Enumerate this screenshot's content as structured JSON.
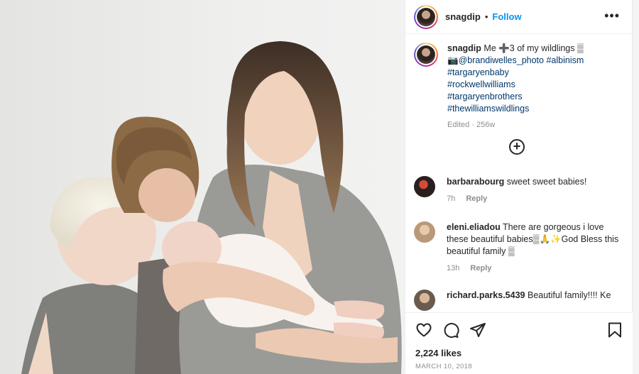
{
  "post": {
    "username": "snagdip",
    "follow_label": "Follow",
    "separator": "•",
    "more_label": "•••"
  },
  "caption": {
    "username": "snagdip",
    "text": "Me ➕3 of my wildlings ▒",
    "photo_credit": "📷@brandiwelles_photo",
    "hashtags": [
      "#albinism",
      "#targaryenbaby",
      "#rockwellwilliams",
      "#targaryenbrothers",
      "#thewilliamswildlings"
    ],
    "meta": "Edited · 256w"
  },
  "load_more_icon": "plus-circle-icon",
  "comments": [
    {
      "username": "barbarabourg",
      "text": "sweet sweet babies!",
      "time": "7h",
      "reply_label": "Reply",
      "avatar_color": "#3a2a2a"
    },
    {
      "username": "eleni.eliadou",
      "text": "There are gorgeous i love these beautiful babies▒🙏✨God Bless this beautiful family ▒",
      "time": "13h",
      "reply_label": "Reply",
      "avatar_color": "#b89a7a"
    },
    {
      "username": "richard.parks.5439",
      "text": "Beautiful family!!!! Ke",
      "avatar_color": "#6b5a4e"
    }
  ],
  "actions": {
    "like_icon": "heart-icon",
    "comment_icon": "comment-icon",
    "share_icon": "send-icon",
    "save_icon": "bookmark-icon"
  },
  "likes": "2,224 likes",
  "date": "MARCH 10, 2018",
  "colors": {
    "accent": "#0095f6",
    "hashtag": "#00376b",
    "muted": "#8e8e8e",
    "text": "#262626"
  }
}
